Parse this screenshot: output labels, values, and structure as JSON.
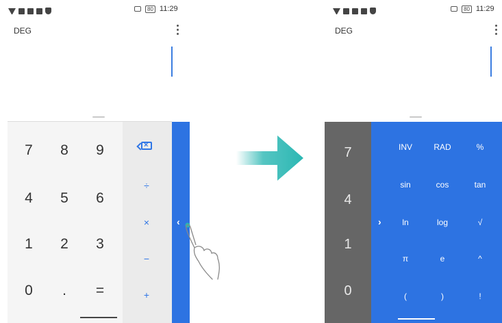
{
  "left_screen": {
    "status": {
      "time": "11:29",
      "battery": "80"
    },
    "mode": "DEG",
    "keys": {
      "digits": [
        [
          "7",
          "8",
          "9"
        ],
        [
          "4",
          "5",
          "6"
        ],
        [
          "1",
          "2",
          "3"
        ],
        [
          "0",
          ".",
          "="
        ]
      ],
      "operators": [
        "÷",
        "×",
        "−",
        "+"
      ]
    }
  },
  "right_screen": {
    "status": {
      "time": "11:29",
      "battery": "80"
    },
    "mode": "DEG",
    "digit_column": [
      "7",
      "4",
      "1",
      "0"
    ],
    "sci_keys": [
      [
        "INV",
        "RAD",
        "%"
      ],
      [
        "sin",
        "cos",
        "tan"
      ],
      [
        "ln",
        "log",
        "√"
      ],
      [
        "π",
        "e",
        "^"
      ],
      [
        "(",
        ")",
        "!"
      ]
    ],
    "collapse_glyph": "›"
  },
  "expand_glyph": "‹",
  "colors": {
    "accent": "#2d73e2",
    "gray_column": "#666666",
    "arrow": "#2bb7b3"
  },
  "icons": [
    "wifi-icon",
    "sim-icon",
    "backspace-icon",
    "more-vert-icon",
    "hand-tap-icon",
    "arrow-right-icon"
  ]
}
